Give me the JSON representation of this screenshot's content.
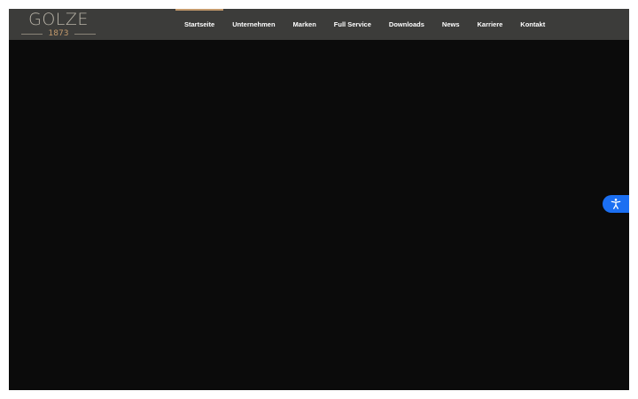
{
  "logo": {
    "name": "GOLZE",
    "year": "1873"
  },
  "nav": {
    "items": [
      {
        "label": "Startseite",
        "active": true
      },
      {
        "label": "Unternehmen",
        "active": false
      },
      {
        "label": "Marken",
        "active": false
      },
      {
        "label": "Full Service",
        "active": false
      },
      {
        "label": "Downloads",
        "active": false
      },
      {
        "label": "News",
        "active": false
      },
      {
        "label": "Karriere",
        "active": false
      },
      {
        "label": "Kontakt",
        "active": false
      }
    ]
  },
  "accessibility": {
    "icon": "accessibility-icon"
  },
  "colors": {
    "header_bg": "#3c3c3a",
    "hero_bg": "#0b0b0b",
    "accent_gold": "#c49a6c",
    "accessibility_blue": "#1b6ff2"
  }
}
